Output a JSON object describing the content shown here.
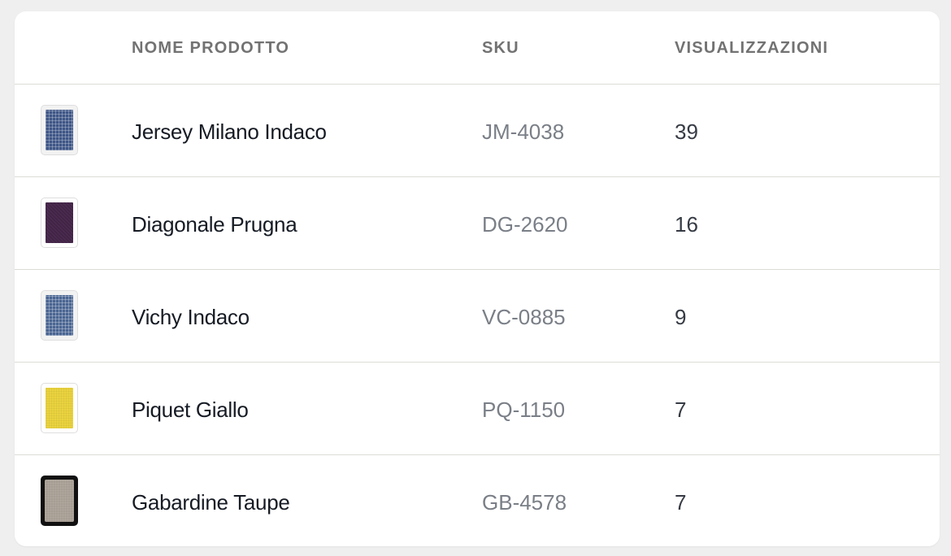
{
  "table": {
    "columns": {
      "image": "",
      "name": "NOME PRODOTTO",
      "sku": "SKU",
      "views": "VISUALIZZAZIONI"
    },
    "rows": [
      {
        "name": "Jersey Milano Indaco",
        "sku": "JM-4038",
        "views": "39",
        "swatch_icon": "fabric-swatch-icon",
        "swatch_color": "#3e5686",
        "swatch_pattern": "check"
      },
      {
        "name": "Diagonale Prugna",
        "sku": "DG-2620",
        "views": "16",
        "swatch_icon": "fabric-swatch-icon",
        "swatch_color": "#4a2a4f",
        "swatch_pattern": "twill"
      },
      {
        "name": "Vichy Indaco",
        "sku": "VC-0885",
        "views": "9",
        "swatch_icon": "fabric-swatch-icon",
        "swatch_color": "#4a6592",
        "swatch_pattern": "check"
      },
      {
        "name": "Piquet Giallo",
        "sku": "PQ-1150",
        "views": "7",
        "swatch_icon": "fabric-swatch-icon",
        "swatch_color": "#ead33f",
        "swatch_pattern": "solid"
      },
      {
        "name": "Gabardine Taupe",
        "sku": "GB-4578",
        "views": "7",
        "swatch_icon": "fabric-swatch-icon",
        "swatch_color": "#a69d93",
        "swatch_pattern": "solid",
        "thumb_style": "dark"
      }
    ]
  }
}
